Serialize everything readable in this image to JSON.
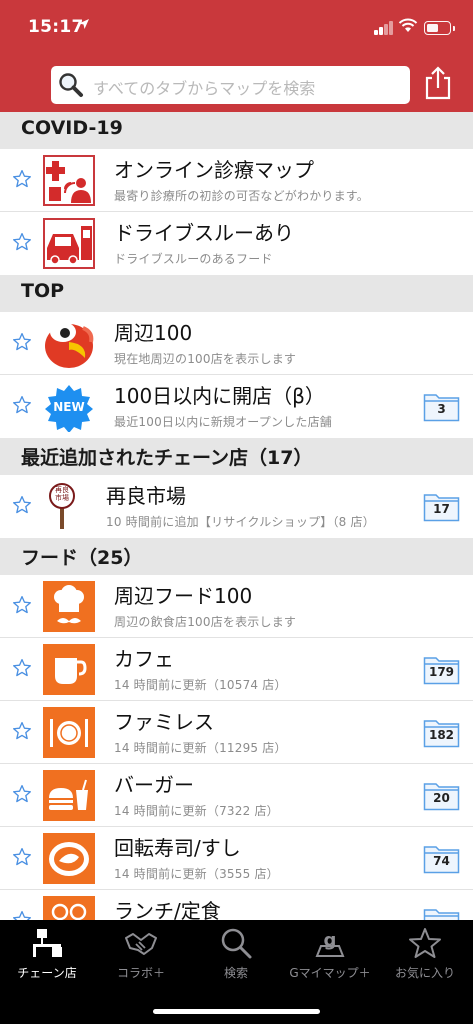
{
  "status": {
    "time": "15:17"
  },
  "search": {
    "placeholder": "すべてのタブからマップを検索"
  },
  "sections": [
    {
      "header": "COVID-19"
    },
    {
      "header": "TOP"
    },
    {
      "header": "最近追加されたチェーン店（17）"
    },
    {
      "header": "フード（25）"
    }
  ],
  "rows": {
    "online": {
      "title": "オンライン診療マップ",
      "subtitle": "最寄り診療所の初診の可否などがわかります。"
    },
    "drive": {
      "title": "ドライブスルーあり",
      "subtitle": "ドライブスルーのあるフード"
    },
    "near100": {
      "title": "周辺100",
      "subtitle": "現在地周辺の100店を表示します"
    },
    "new100": {
      "title": "100日以内に開店（β）",
      "subtitle": "最近100日以内に新規オープンした店舗",
      "count": "3",
      "badge": "NEW"
    },
    "sairyo": {
      "title": "再良市場",
      "subtitle": "10 時間前に追加【リサイクルショップ】（8 店）",
      "count": "17",
      "sign": "再良市場"
    },
    "food100": {
      "title": "周辺フード100",
      "subtitle": "周辺の飲食店100店を表示します"
    },
    "cafe": {
      "title": "カフェ",
      "subtitle": "14 時間前に更新（10574 店）",
      "count": "179"
    },
    "family": {
      "title": "ファミレス",
      "subtitle": "14 時間前に更新（11295 店）",
      "count": "182"
    },
    "burger": {
      "title": "バーガー",
      "subtitle": "14 時間前に更新（7322 店）",
      "count": "20"
    },
    "sushi": {
      "title": "回転寿司/すし",
      "subtitle": "14 時間前に更新（3555 店）",
      "count": "74"
    },
    "lunch": {
      "title": "ランチ/定食"
    }
  },
  "tabs": [
    {
      "label": "チェーン店",
      "icon": "chain-store-icon",
      "active": true
    },
    {
      "label": "コラボ＋",
      "icon": "handshake-icon"
    },
    {
      "label": "検索",
      "icon": "search-icon"
    },
    {
      "label": "Gマイマップ＋",
      "icon": "g-mymap-icon"
    },
    {
      "label": "お気に入り",
      "icon": "star-icon"
    }
  ],
  "colors": {
    "header_red": "#c9383c",
    "food_orange": "#f07020",
    "accent_blue": "#4a90e2",
    "section_gray": "#e6e6e6"
  }
}
